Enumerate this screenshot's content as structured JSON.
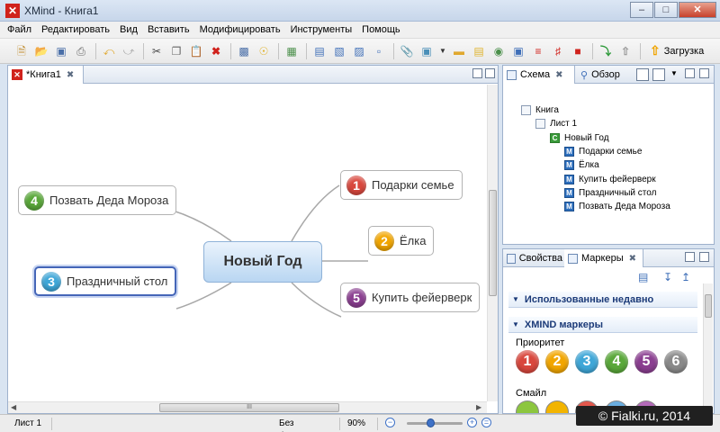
{
  "window": {
    "title": "XMind - Книга1",
    "app_icon": "✕"
  },
  "menu": [
    "Файл",
    "Редактировать",
    "Вид",
    "Вставить",
    "Модифицировать",
    "Инструменты",
    "Помощь"
  ],
  "toolbar": {
    "icons": [
      "new-icon",
      "open-icon",
      "save-icon",
      "print-icon",
      "undo-icon",
      "redo-icon",
      "cut-icon",
      "copy-icon",
      "paste-icon",
      "delete-icon",
      "zoom-icon",
      "bulb-icon",
      "topic-icon",
      "subtopic-icon",
      "sibling-icon",
      "floating-icon",
      "boundary-icon",
      "relationship-icon",
      "attachment-icon",
      "image-icon",
      "label-icon",
      "note-icon",
      "chart-icon",
      "plus-icon",
      "dots-icon",
      "equation-icon",
      "marker-icon",
      "stop-icon",
      "drill-down-icon",
      "drill-up-icon"
    ],
    "upload_label": "Загрузка"
  },
  "editor": {
    "tab_label": "*Книга1",
    "central_topic": "Новый Год",
    "topics": [
      {
        "label": "Подарки семье",
        "marker": "1",
        "color": "#d9473d"
      },
      {
        "label": "Ёлка",
        "marker": "2",
        "color": "#f2a600"
      },
      {
        "label": "Купить фейерверк",
        "marker": "5",
        "color": "#8b3f91"
      },
      {
        "label": "Позвать Деда Мороза",
        "marker": "4",
        "color": "#5aa83a"
      },
      {
        "label": "Праздничный стол",
        "marker": "3",
        "color": "#3fa7d8"
      }
    ],
    "scroll_grip": "III"
  },
  "outline": {
    "tabs": [
      "Схема",
      "Обзор"
    ],
    "tree": [
      {
        "label": "Книга",
        "icon": ""
      },
      {
        "label": "Лист 1",
        "icon": ""
      },
      {
        "label": "Новый Год",
        "icon": "C"
      },
      {
        "label": "Подарки семье",
        "icon": "M"
      },
      {
        "label": "Ёлка",
        "icon": "M"
      },
      {
        "label": "Купить фейерверк",
        "icon": "M"
      },
      {
        "label": "Праздничный стол",
        "icon": "M"
      },
      {
        "label": "Позвать Деда Мороза",
        "icon": "M"
      }
    ]
  },
  "markers_panel": {
    "tabs": [
      "Свойства",
      "Маркеры"
    ],
    "recent_header": "Использованные недавно",
    "xmind_header": "XMIND маркеры",
    "priority_label": "Приоритет",
    "priority_markers": [
      {
        "n": "1",
        "color": "#d9473d"
      },
      {
        "n": "2",
        "color": "#f2a600"
      },
      {
        "n": "3",
        "color": "#3fa7d8"
      },
      {
        "n": "4",
        "color": "#5aa83a"
      },
      {
        "n": "5",
        "color": "#8b3f91"
      },
      {
        "n": "6",
        "color": "#8a8a8a"
      }
    ],
    "smiley_label": "Смайл"
  },
  "status": {
    "sheet": "Лист 1",
    "filter": "Без фильтра",
    "zoom": "90%"
  },
  "watermark": "© Fialki.ru, 2014"
}
